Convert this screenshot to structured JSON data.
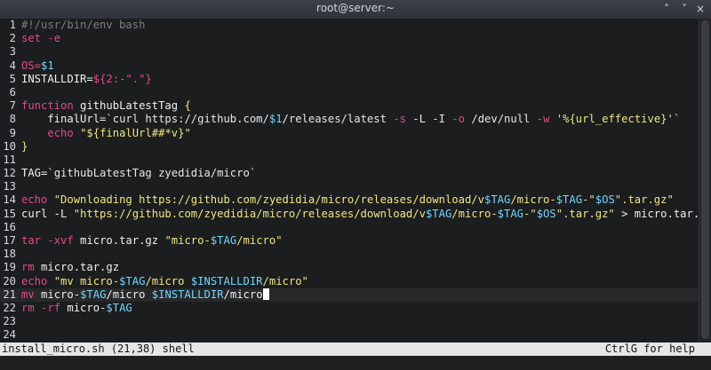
{
  "window": {
    "title": "root@server:~",
    "buttons": [
      "˄",
      "˅",
      "×"
    ]
  },
  "editor": {
    "lines": [
      {
        "n": "1",
        "segments": [
          {
            "t": "#!/usr/bin/env bash",
            "c": "comment"
          }
        ]
      },
      {
        "n": "2",
        "segments": [
          {
            "t": "set",
            "c": "keyword"
          },
          {
            "t": " "
          },
          {
            "t": "-e",
            "c": "flag"
          }
        ]
      },
      {
        "n": "3",
        "segments": []
      },
      {
        "n": "4",
        "segments": [
          {
            "t": "OS=",
            "c": "keyword"
          },
          {
            "t": "$1",
            "c": "var"
          }
        ]
      },
      {
        "n": "5",
        "segments": [
          {
            "t": "INSTALLDIR="
          },
          {
            "t": "${2:-\".\"}",
            "c": "keyword"
          }
        ]
      },
      {
        "n": "6",
        "segments": []
      },
      {
        "n": "7",
        "segments": [
          {
            "t": "function",
            "c": "keyword"
          },
          {
            "t": " githubLatestTag "
          },
          {
            "t": "{",
            "c": "string"
          }
        ]
      },
      {
        "n": "8",
        "segments": [
          {
            "t": "    finalUrl="
          },
          {
            "t": "`curl https://github.com/",
            "c": "cmd"
          },
          {
            "t": "$1",
            "c": "var"
          },
          {
            "t": "/releases/latest ",
            "c": "cmd"
          },
          {
            "t": "-s",
            "c": "flag"
          },
          {
            "t": " -L -I ",
            "c": "cmd"
          },
          {
            "t": "-o",
            "c": "flag"
          },
          {
            "t": " /dev/null ",
            "c": "cmd"
          },
          {
            "t": "-w",
            "c": "flag"
          },
          {
            "t": " '",
            "c": "string"
          },
          {
            "t": "%{url_effective}",
            "c": "string"
          },
          {
            "t": "'`",
            "c": "cmd"
          }
        ]
      },
      {
        "n": "9",
        "segments": [
          {
            "t": "    "
          },
          {
            "t": "echo",
            "c": "keyword"
          },
          {
            "t": " "
          },
          {
            "t": "\"${finalUrl##*v}\"",
            "c": "string"
          }
        ]
      },
      {
        "n": "10",
        "segments": [
          {
            "t": "}",
            "c": "string"
          }
        ]
      },
      {
        "n": "11",
        "segments": []
      },
      {
        "n": "12",
        "segments": [
          {
            "t": "TAG="
          },
          {
            "t": "`githubLatestTag zyedidia/micro`",
            "c": "cmd"
          }
        ]
      },
      {
        "n": "13",
        "segments": []
      },
      {
        "n": "14",
        "segments": [
          {
            "t": "echo",
            "c": "keyword"
          },
          {
            "t": " "
          },
          {
            "t": "\"Downloading https://github.com/zyedidia/micro/releases/download/v",
            "c": "string"
          },
          {
            "t": "$TAG",
            "c": "var"
          },
          {
            "t": "/micro-",
            "c": "string"
          },
          {
            "t": "$TAG",
            "c": "var"
          },
          {
            "t": "-\"",
            "c": "string"
          },
          {
            "t": "$OS",
            "c": "var"
          },
          {
            "t": "\".tar.gz\"",
            "c": "string"
          }
        ]
      },
      {
        "n": "15",
        "segments": [
          {
            "t": "curl -L "
          },
          {
            "t": "\"https://github.com/zyedidia/micro/releases/download/v",
            "c": "string"
          },
          {
            "t": "$TAG",
            "c": "var"
          },
          {
            "t": "/micro-",
            "c": "string"
          },
          {
            "t": "$TAG",
            "c": "var"
          },
          {
            "t": "-\"",
            "c": "string"
          },
          {
            "t": "$OS",
            "c": "var"
          },
          {
            "t": "\".tar.gz\"",
            "c": "string"
          },
          {
            "t": " > micro.tar.gz"
          }
        ]
      },
      {
        "n": "16",
        "segments": []
      },
      {
        "n": "17",
        "segments": [
          {
            "t": "tar",
            "c": "keyword"
          },
          {
            "t": " "
          },
          {
            "t": "-xvf",
            "c": "flag"
          },
          {
            "t": " micro.tar.gz "
          },
          {
            "t": "\"micro-",
            "c": "string"
          },
          {
            "t": "$TAG",
            "c": "var"
          },
          {
            "t": "/micro\"",
            "c": "string"
          }
        ]
      },
      {
        "n": "18",
        "segments": []
      },
      {
        "n": "19",
        "segments": [
          {
            "t": "rm",
            "c": "keyword"
          },
          {
            "t": " micro.tar.gz"
          }
        ]
      },
      {
        "n": "20",
        "segments": [
          {
            "t": "echo",
            "c": "keyword"
          },
          {
            "t": " "
          },
          {
            "t": "\"mv micro-",
            "c": "string"
          },
          {
            "t": "$TAG",
            "c": "var"
          },
          {
            "t": "/micro ",
            "c": "string"
          },
          {
            "t": "$INSTALLDIR",
            "c": "var"
          },
          {
            "t": "/micro\"",
            "c": "string"
          }
        ]
      },
      {
        "n": "21",
        "current": true,
        "segments": [
          {
            "t": "mv",
            "c": "keyword"
          },
          {
            "t": " micro-"
          },
          {
            "t": "$TAG",
            "c": "var"
          },
          {
            "t": "/micro "
          },
          {
            "t": "$INSTALLDIR",
            "c": "var"
          },
          {
            "t": "/micro"
          }
        ]
      },
      {
        "n": "22",
        "segments": [
          {
            "t": "rm",
            "c": "keyword"
          },
          {
            "t": " "
          },
          {
            "t": "-rf",
            "c": "flag"
          },
          {
            "t": " micro-"
          },
          {
            "t": "$TAG",
            "c": "var"
          }
        ]
      },
      {
        "n": "23",
        "segments": []
      },
      {
        "n": "24",
        "segments": []
      }
    ]
  },
  "statusbar": {
    "left": "install_micro.sh (21,38) shell",
    "right": "CtrlG for help"
  }
}
